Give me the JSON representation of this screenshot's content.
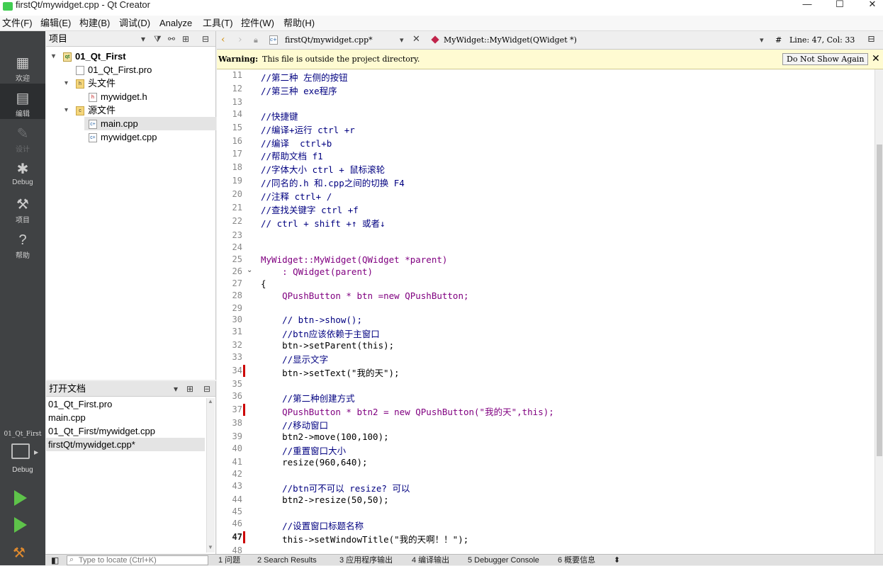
{
  "window": {
    "title": "firstQt/mywidget.cpp - Qt Creator",
    "minimize": "—",
    "maximize": "☐",
    "close": "✕"
  },
  "menubar": [
    "文件(F)",
    "编辑(E)",
    "构建(B)",
    "调试(D)",
    "Analyze",
    "工具(T)",
    "控件(W)",
    "帮助(H)"
  ],
  "modes": [
    {
      "label": "欢迎",
      "icon": "welcome-grid-icon"
    },
    {
      "label": "编辑",
      "icon": "edit-document-icon"
    },
    {
      "label": "设计",
      "icon": "design-pen-icon"
    },
    {
      "label": "Debug",
      "icon": "debug-bug-icon"
    },
    {
      "label": "项目",
      "icon": "projects-wrench-icon"
    },
    {
      "label": "帮助",
      "icon": "help-question-icon"
    }
  ],
  "kit": {
    "project": "01_Qt_First",
    "label": "Debug"
  },
  "project_panel": {
    "title": "项目"
  },
  "tree": [
    {
      "label": "01_Qt_First",
      "type": "project",
      "bold": true
    },
    {
      "label": "01_Qt_First.pro",
      "type": "pro"
    },
    {
      "label": "头文件",
      "type": "folder"
    },
    {
      "label": "mywidget.h",
      "type": "header"
    },
    {
      "label": "源文件",
      "type": "folder"
    },
    {
      "label": "main.cpp",
      "type": "cpp",
      "selected": true
    },
    {
      "label": "mywidget.cpp",
      "type": "cpp"
    }
  ],
  "open_docs": {
    "title": "打开文档",
    "items": [
      "01_Qt_First.pro",
      "main.cpp",
      "01_Qt_First/mywidget.cpp",
      "firstQt/mywidget.cpp*"
    ]
  },
  "editor": {
    "file": "firstQt/mywidget.cpp*",
    "symbol": "MyWidget::MyWidget(QWidget *)",
    "hash": "#",
    "position": "Line: 47, Col: 33"
  },
  "warning": {
    "label": "Warning:",
    "text": "This file is outside the project directory.",
    "button": "Do Not Show Again"
  },
  "code_lines": [
    {
      "n": 11,
      "t": "//第二种 左侧的按钮",
      "k": "com"
    },
    {
      "n": 12,
      "t": "//第三种 exe程序",
      "k": "com"
    },
    {
      "n": 13,
      "t": "",
      "k": ""
    },
    {
      "n": 14,
      "t": "//快捷键",
      "k": "com"
    },
    {
      "n": 15,
      "t": "//编译+运行 ctrl +r",
      "k": "com"
    },
    {
      "n": 16,
      "t": "//编译  ctrl+b",
      "k": "com"
    },
    {
      "n": 17,
      "t": "//帮助文档 f1",
      "k": "com"
    },
    {
      "n": 18,
      "t": "//字体大小 ctrl + 鼠标滚轮",
      "k": "com"
    },
    {
      "n": 19,
      "t": "//同名的.h 和.cpp之间的切换 F4",
      "k": "com"
    },
    {
      "n": 20,
      "t": "//注释 ctrl+ /",
      "k": "com"
    },
    {
      "n": 21,
      "t": "//查找关键字 ctrl +f",
      "k": "com"
    },
    {
      "n": 22,
      "t": "// ctrl + shift +↑ 或者↓",
      "k": "com"
    },
    {
      "n": 23,
      "t": "",
      "k": ""
    },
    {
      "n": 24,
      "t": "",
      "k": ""
    },
    {
      "n": 25,
      "t": "MyWidget::MyWidget(QWidget *parent)",
      "k": "ctor"
    },
    {
      "n": 26,
      "t": "    : QWidget(parent)",
      "k": "init"
    },
    {
      "n": 27,
      "t": "{",
      "k": ""
    },
    {
      "n": 28,
      "t": "    QPushButton * btn =new QPushButton;",
      "k": "decl"
    },
    {
      "n": 29,
      "t": "",
      "k": ""
    },
    {
      "n": 30,
      "t": "    // btn->show();",
      "k": "com"
    },
    {
      "n": 31,
      "t": "    //btn应该依赖于主窗口",
      "k": "com"
    },
    {
      "n": 32,
      "t": "    btn->setParent(this);",
      "k": "this"
    },
    {
      "n": 33,
      "t": "    //显示文字",
      "k": "com"
    },
    {
      "n": 34,
      "t": "    btn->setText(\"我的天\");",
      "k": "str"
    },
    {
      "n": 35,
      "t": "",
      "k": ""
    },
    {
      "n": 36,
      "t": "    //第二种创建方式",
      "k": "com"
    },
    {
      "n": 37,
      "t": "    QPushButton * btn2 = new QPushButton(\"我的天\",this);",
      "k": "decl2"
    },
    {
      "n": 38,
      "t": "    //移动窗口",
      "k": "com"
    },
    {
      "n": 39,
      "t": "    btn2->move(100,100);",
      "k": "num"
    },
    {
      "n": 40,
      "t": "    //重置窗口大小",
      "k": "com"
    },
    {
      "n": 41,
      "t": "    resize(960,640);",
      "k": "num"
    },
    {
      "n": 42,
      "t": "",
      "k": ""
    },
    {
      "n": 43,
      "t": "    //btn可不可以 resize? 可以",
      "k": "com"
    },
    {
      "n": 44,
      "t": "    btn2->resize(50,50);",
      "k": "num"
    },
    {
      "n": 45,
      "t": "",
      "k": ""
    },
    {
      "n": 46,
      "t": "    //设置窗口标题名称",
      "k": "com"
    },
    {
      "n": 47,
      "t": "    this->setWindowTitle(\"我的天啊！！\");",
      "k": "title"
    },
    {
      "n": 48,
      "t": "",
      "k": ""
    }
  ],
  "modified_lines": [
    34,
    37,
    47
  ],
  "current_line": 47,
  "fold_line": 26,
  "locator": {
    "placeholder": "Type to locate (Ctrl+K)"
  },
  "output_tabs": [
    "1 问题",
    "2 Search Results",
    "3 应用程序输出",
    "4 编译输出",
    "5 Debugger Console",
    "6 概要信息"
  ],
  "colors": {
    "modebar": "#404244",
    "comment": "#000080",
    "type": "#800080",
    "keyword": "#808000",
    "string": "#008000",
    "modified_marker": "#cc0000"
  }
}
